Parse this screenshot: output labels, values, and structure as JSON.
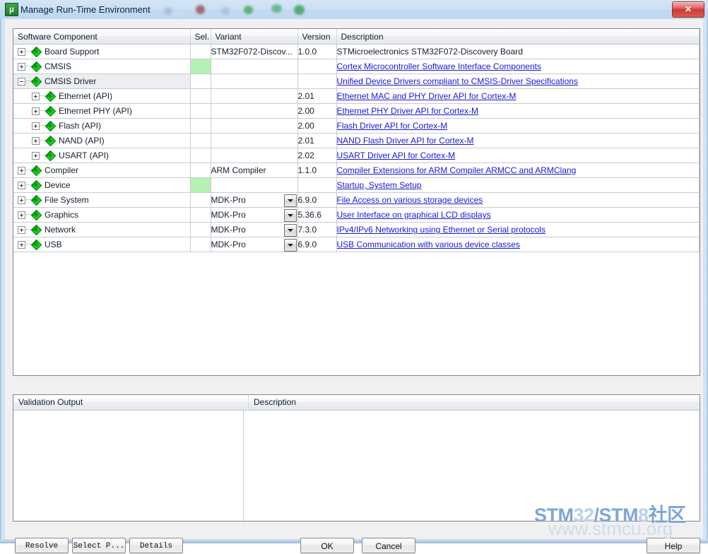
{
  "window": {
    "title": "Manage Run-Time Environment",
    "icon": "keil-uvision-icon",
    "close_label": "✕"
  },
  "table": {
    "headers": {
      "component": "Software Component",
      "sel": "Sel.",
      "variant": "Variant",
      "version": "Version",
      "description": "Description"
    },
    "rows": [
      {
        "name": "Board Support",
        "level": 1,
        "expander": "plus",
        "selected": false,
        "sel_on": false,
        "variant": "STM32F072-Discov...",
        "has_dropdown": false,
        "version": "1.0.0",
        "description": "STMicroelectronics STM32F072-Discovery Board",
        "is_link": false
      },
      {
        "name": "CMSIS",
        "level": 1,
        "expander": "plus",
        "selected": false,
        "sel_on": true,
        "variant": "",
        "has_dropdown": false,
        "version": "",
        "description": "Cortex Microcontroller Software Interface Components",
        "is_link": true
      },
      {
        "name": "CMSIS Driver",
        "level": 1,
        "expander": "minus",
        "selected": true,
        "sel_on": false,
        "variant": "",
        "has_dropdown": false,
        "version": "",
        "description": "Unified Device Drivers compliant to CMSIS-Driver Specifications",
        "is_link": true
      },
      {
        "name": "Ethernet (API)",
        "level": 2,
        "expander": "plus",
        "selected": false,
        "sel_on": false,
        "variant": "",
        "has_dropdown": false,
        "version": "2.01",
        "description": "Ethernet MAC and PHY Driver API for Cortex-M",
        "is_link": true
      },
      {
        "name": "Ethernet PHY (API)",
        "level": 2,
        "expander": "plus",
        "selected": false,
        "sel_on": false,
        "variant": "",
        "has_dropdown": false,
        "version": "2.00",
        "description": "Ethernet PHY Driver API for Cortex-M",
        "is_link": true
      },
      {
        "name": "Flash (API)",
        "level": 2,
        "expander": "plus",
        "selected": false,
        "sel_on": false,
        "variant": "",
        "has_dropdown": false,
        "version": "2.00",
        "description": "Flash Driver API for Cortex-M",
        "is_link": true
      },
      {
        "name": "NAND (API)",
        "level": 2,
        "expander": "plus",
        "selected": false,
        "sel_on": false,
        "variant": "",
        "has_dropdown": false,
        "version": "2.01",
        "description": "NAND Flash Driver API for Cortex-M",
        "is_link": true
      },
      {
        "name": "USART (API)",
        "level": 2,
        "expander": "plus",
        "selected": false,
        "sel_on": false,
        "variant": "",
        "has_dropdown": false,
        "version": "2.02",
        "description": "USART Driver API for Cortex-M",
        "is_link": true
      },
      {
        "name": "Compiler",
        "level": 1,
        "expander": "plus",
        "selected": false,
        "sel_on": false,
        "variant": "ARM Compiler",
        "has_dropdown": false,
        "version": "1.1.0",
        "description": "Compiler Extensions for ARM Compiler ARMCC and ARMClang",
        "is_link": true
      },
      {
        "name": "Device",
        "level": 1,
        "expander": "plus",
        "selected": false,
        "sel_on": true,
        "variant": "",
        "has_dropdown": false,
        "version": "",
        "description": "Startup, System Setup",
        "is_link": true
      },
      {
        "name": "File System",
        "level": 1,
        "expander": "plus",
        "selected": false,
        "sel_on": false,
        "variant": "MDK-Pro",
        "has_dropdown": true,
        "version": "6.9.0",
        "description": "File Access on various storage devices",
        "is_link": true
      },
      {
        "name": "Graphics",
        "level": 1,
        "expander": "plus",
        "selected": false,
        "sel_on": false,
        "variant": "MDK-Pro",
        "has_dropdown": true,
        "version": "5.36.6",
        "description": "User Interface on graphical LCD displays",
        "is_link": true
      },
      {
        "name": "Network",
        "level": 1,
        "expander": "plus",
        "selected": false,
        "sel_on": false,
        "variant": "MDK-Pro",
        "has_dropdown": true,
        "version": "7.3.0",
        "description": "IPv4/IPv6 Networking using Ethernet or Serial protocols",
        "is_link": true
      },
      {
        "name": "USB",
        "level": 1,
        "expander": "plus",
        "selected": false,
        "sel_on": false,
        "variant": "MDK-Pro",
        "has_dropdown": true,
        "version": "6.9.0",
        "description": "USB Communication with various device classes",
        "is_link": true
      }
    ]
  },
  "validation": {
    "header_output": "Validation Output",
    "header_description": "Description",
    "rows": []
  },
  "buttons": {
    "resolve": "Resolve",
    "select_packs": "Select P...",
    "details": "Details",
    "ok": "OK",
    "cancel": "Cancel",
    "help": "Help"
  },
  "watermark": {
    "line1_a": "STM",
    "line1_b": "32",
    "line1_c": "/STM",
    "line1_d": "8",
    "line1_e": "社区",
    "line2": "www.stmcu.org"
  },
  "colors": {
    "selected_cell_green": "#b4f2b4",
    "link_blue": "#1818d0",
    "row_highlight": "#eceef1",
    "title_glass": "#cbdff3"
  }
}
